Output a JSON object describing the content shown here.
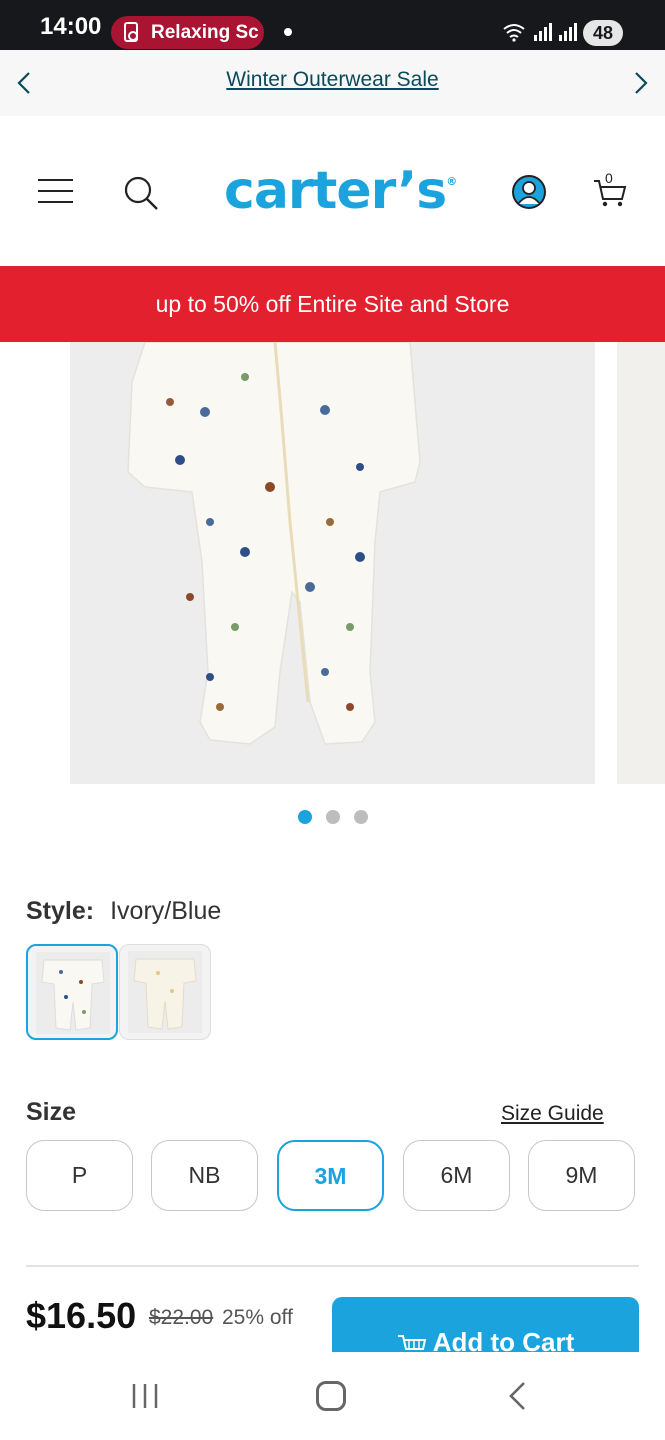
{
  "status_bar": {
    "time": "14:00",
    "media_app": "Relaxing Sc",
    "battery": "48"
  },
  "promo_nav": {
    "link_text": "Winter Outerwear Sale"
  },
  "header": {
    "logo": "carter’s",
    "logo_mark": "®",
    "cart_count": "0"
  },
  "sale_banner": {
    "text": "up to 50% off Entire Site and Store"
  },
  "carousel": {
    "slide_count": 3,
    "active_index": 0
  },
  "style": {
    "label": "Style:",
    "value": "Ivory/Blue",
    "swatch_count": 2,
    "selected_swatch": 0
  },
  "size": {
    "label": "Size",
    "guide_link": "Size Guide",
    "options": [
      "P",
      "NB",
      "3M",
      "6M",
      "9M"
    ],
    "selected": "3M"
  },
  "price": {
    "current": "$16.50",
    "original": "$22.00",
    "discount": "25% off"
  },
  "cart_button": {
    "label": "Add to Cart"
  },
  "colors": {
    "brand_blue": "#1aa3dd",
    "sale_red": "#e2202e",
    "status_bar": "#17181c",
    "media_pill": "#a81432"
  }
}
